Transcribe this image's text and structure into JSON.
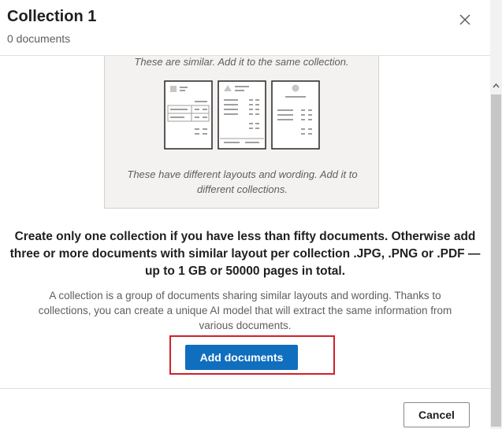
{
  "header": {
    "title": "Collection 1",
    "subtitle": "0 documents"
  },
  "illustration": {
    "similar_caption": "These are similar. Add it to the same collection.",
    "different_caption": "These have different layouts and wording. Add it to different collections."
  },
  "content": {
    "main_text": "Create only one collection if you have less than fifty documents. Otherwise add three or more documents with similar layout per collection .JPG, .PNG or .PDF — up to 1 GB or 50000 pages in total.",
    "description": "A collection is a group of documents sharing similar layouts and wording. Thanks to collections, you can create a unique AI model that will extract the same information from various documents."
  },
  "actions": {
    "add_documents_label": "Add documents",
    "cancel_label": "Cancel"
  },
  "colors": {
    "primary": "#106ebe",
    "highlight": "#d1202a"
  }
}
